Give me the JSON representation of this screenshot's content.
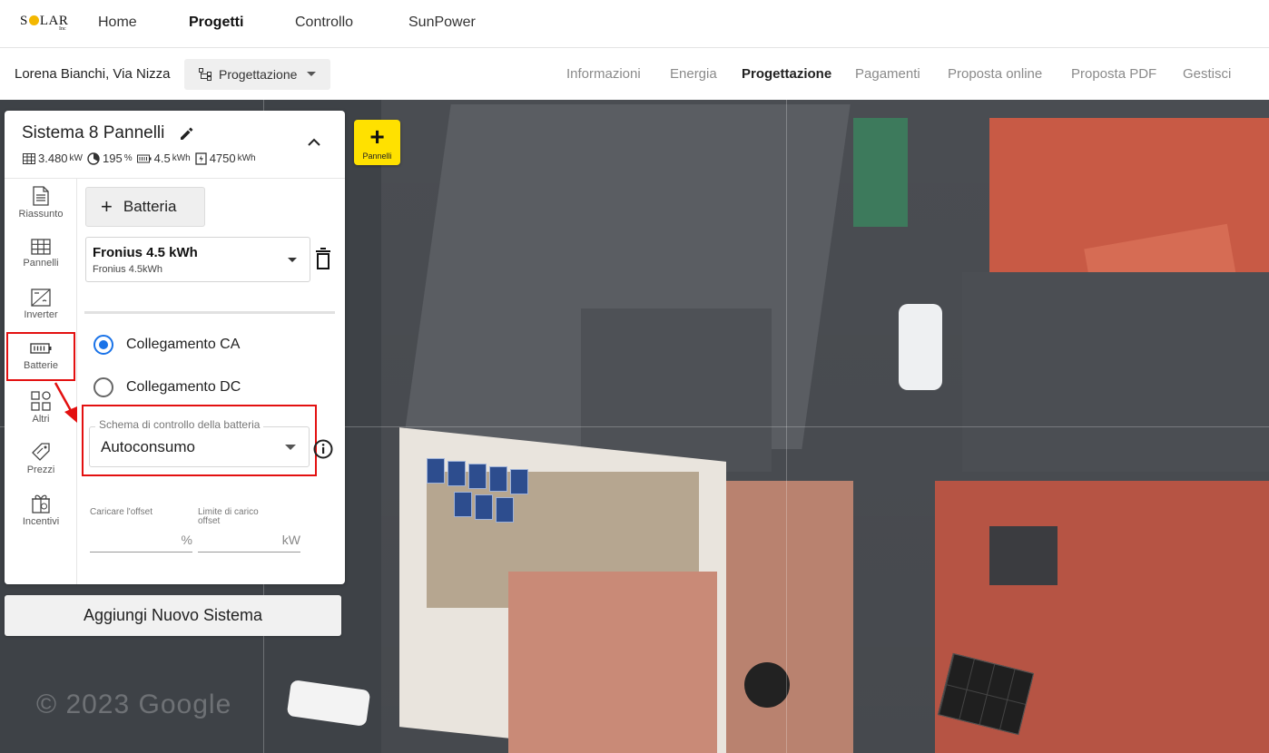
{
  "brand": {
    "logo_left": "S",
    "logo_right": "LAR",
    "logo_suffix": "Inc"
  },
  "topnav": {
    "items": [
      "Home",
      "Progetti",
      "Controllo",
      "SunPower"
    ],
    "active": "Progetti"
  },
  "subheader": {
    "customer": "Lorena Bianchi, Via Nizza",
    "mode_button": "Progettazione",
    "tabs": [
      "Informazioni",
      "Energia",
      "Progettazione",
      "Pagamenti",
      "Proposta online",
      "Proposta PDF",
      "Gestisci"
    ],
    "active_tab": "Progettazione"
  },
  "fab": {
    "label": "Pannelli"
  },
  "system": {
    "title": "Sistema 8 Pannelli",
    "stats": [
      {
        "icon": "panel-grid-icon",
        "value": "3.480",
        "unit": "kW"
      },
      {
        "icon": "offset-pie-icon",
        "value": "195",
        "unit": "%"
      },
      {
        "icon": "battery-icon",
        "value": "4.5",
        "unit": "kWh"
      },
      {
        "icon": "energy-bolt-icon",
        "value": "4750",
        "unit": "kWh"
      }
    ]
  },
  "sidenav": [
    {
      "icon": "document-icon",
      "label": "Riassunto"
    },
    {
      "icon": "panels-icon",
      "label": "Pannelli"
    },
    {
      "icon": "inverter-icon",
      "label": "Inverter"
    },
    {
      "icon": "battery-icon",
      "label": "Batterie"
    },
    {
      "icon": "grid-squares-icon",
      "label": "Altri"
    },
    {
      "icon": "price-tag-icon",
      "label": "Prezzi"
    },
    {
      "icon": "gift-icon",
      "label": "Incentivi"
    }
  ],
  "sidenav_active": "Batterie",
  "battery": {
    "add_button": "Batteria",
    "selected_name": "Fronius 4.5 kWh",
    "selected_sub": "Fronius 4.5kWh",
    "connection_options": [
      "Collegamento CA",
      "Collegamento DC"
    ],
    "connection_selected": "Collegamento CA",
    "control_scheme_label": "Schema di controllo della batteria",
    "control_scheme_value": "Autoconsumo",
    "offset_label": "Caricare l'offset",
    "offset_unit": "%",
    "charge_limit_label": "Limite di carico offset",
    "charge_limit_label_line1": "Limite di carico",
    "charge_limit_label_line2": "offset",
    "charge_limit_unit": "kW"
  },
  "add_system_button": "Aggiungi Nuovo Sistema",
  "map": {
    "watermark": "© 2023 Google"
  },
  "colors": {
    "accent_yellow": "#ffe100",
    "radio_blue": "#1a73e8",
    "highlight_red": "#e31010"
  }
}
